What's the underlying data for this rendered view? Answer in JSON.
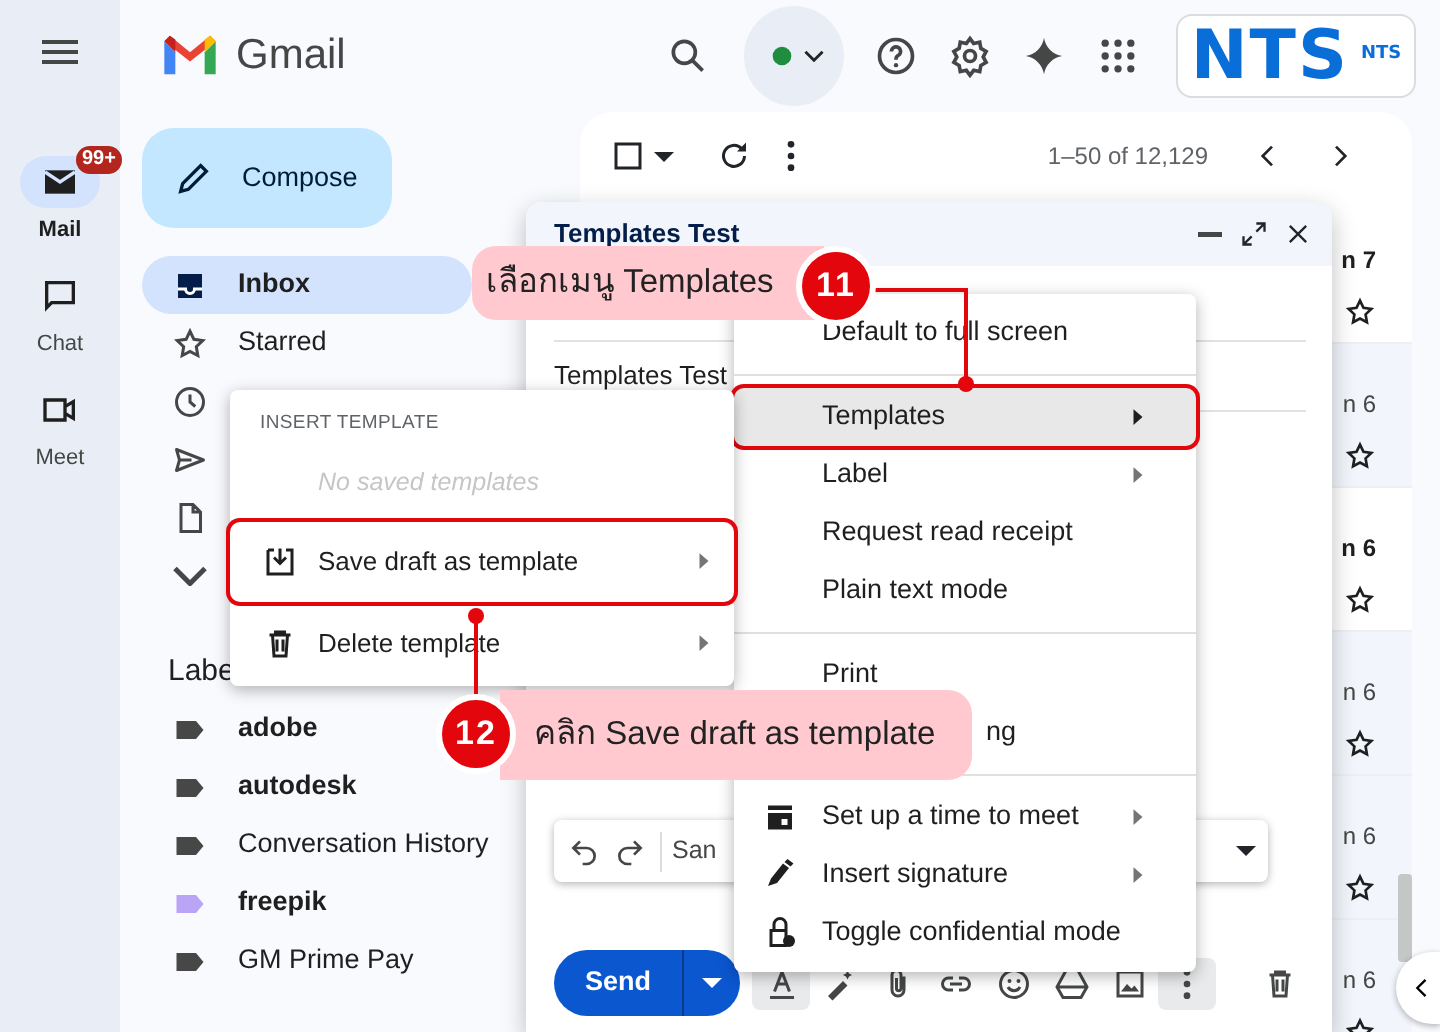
{
  "rail": {
    "items": [
      {
        "kind": "mail",
        "label": "Mail",
        "badge": "99+",
        "selected": true
      },
      {
        "kind": "chat",
        "label": "Chat",
        "selected": false
      },
      {
        "kind": "meet",
        "label": "Meet",
        "selected": false
      }
    ]
  },
  "header": {
    "app_name": "Gmail",
    "logo": {
      "main": "NTS",
      "sub": "NTS"
    }
  },
  "sidebar": {
    "compose": "Compose",
    "folders": [
      {
        "kind": "inbox",
        "label": "Inbox",
        "selected": true
      },
      {
        "kind": "star",
        "label": "Starred",
        "selected": false
      },
      {
        "kind": "clock",
        "selected": false
      },
      {
        "kind": "send",
        "selected": false
      },
      {
        "kind": "file",
        "selected": false
      },
      {
        "kind": "more",
        "selected": false
      }
    ],
    "labels_heading": "Labe",
    "labels": [
      {
        "label": "adobe",
        "unread": true,
        "color": "#474747"
      },
      {
        "label": "autodesk",
        "unread": true,
        "color": "#474747"
      },
      {
        "label": "Conversation History",
        "unread": false,
        "color": "#474747"
      },
      {
        "label": "freepik",
        "unread": true,
        "color": "#b9a4f5"
      },
      {
        "label": "GM Prime Pay",
        "unread": false,
        "color": "#474747"
      }
    ]
  },
  "mail_list": {
    "select_all": {
      "checked": false
    },
    "range": "1–50 of 12,129",
    "rows": [
      {
        "date": "n 7",
        "unread": true
      },
      {
        "date": "n 6",
        "unread": false
      },
      {
        "date": "n 6",
        "unread": true
      },
      {
        "date": "n 6",
        "unread": false
      },
      {
        "date": "n 6",
        "unread": false
      },
      {
        "date": "n 6",
        "unread": false
      }
    ]
  },
  "compose": {
    "title": "Templates Test",
    "subject": "Templates Test",
    "font": "San",
    "send": "Send"
  },
  "more_menu": {
    "items": [
      {
        "kind": "item",
        "label": "Default to full screen",
        "submenu": false,
        "selected": false
      },
      {
        "kind": "divider"
      },
      {
        "kind": "item",
        "label": "Templates",
        "submenu": true,
        "selected": true,
        "highlighted": true
      },
      {
        "kind": "item",
        "label": "Label",
        "submenu": true,
        "selected": false
      },
      {
        "kind": "item",
        "label": "Request read receipt",
        "submenu": false,
        "selected": false
      },
      {
        "kind": "item",
        "label": "Plain text mode",
        "submenu": false,
        "selected": false
      },
      {
        "kind": "divider"
      },
      {
        "kind": "item",
        "label": "Print",
        "submenu": false,
        "selected": false
      },
      {
        "kind": "covered",
        "label": "ng",
        "submenu": false,
        "selected": false
      },
      {
        "kind": "divider"
      },
      {
        "kind": "meet",
        "label": "Set up a time to meet",
        "submenu": true,
        "selected": false
      },
      {
        "kind": "signature",
        "label": "Insert signature",
        "submenu": true,
        "selected": false
      },
      {
        "kind": "confidential",
        "label": "Toggle confidential mode",
        "submenu": false,
        "selected": false
      }
    ]
  },
  "template_menu": {
    "heading": "INSERT TEMPLATE",
    "empty_note": "No saved templates",
    "items": [
      {
        "kind": "save",
        "label": "Save draft as template",
        "submenu": true,
        "highlighted": true
      },
      {
        "kind": "delete",
        "label": "Delete template",
        "submenu": true
      }
    ]
  },
  "callouts": [
    {
      "number": "11",
      "text": "เลือกเมนู Templates"
    },
    {
      "number": "12",
      "text": "คลิก Save draft as template"
    }
  ]
}
